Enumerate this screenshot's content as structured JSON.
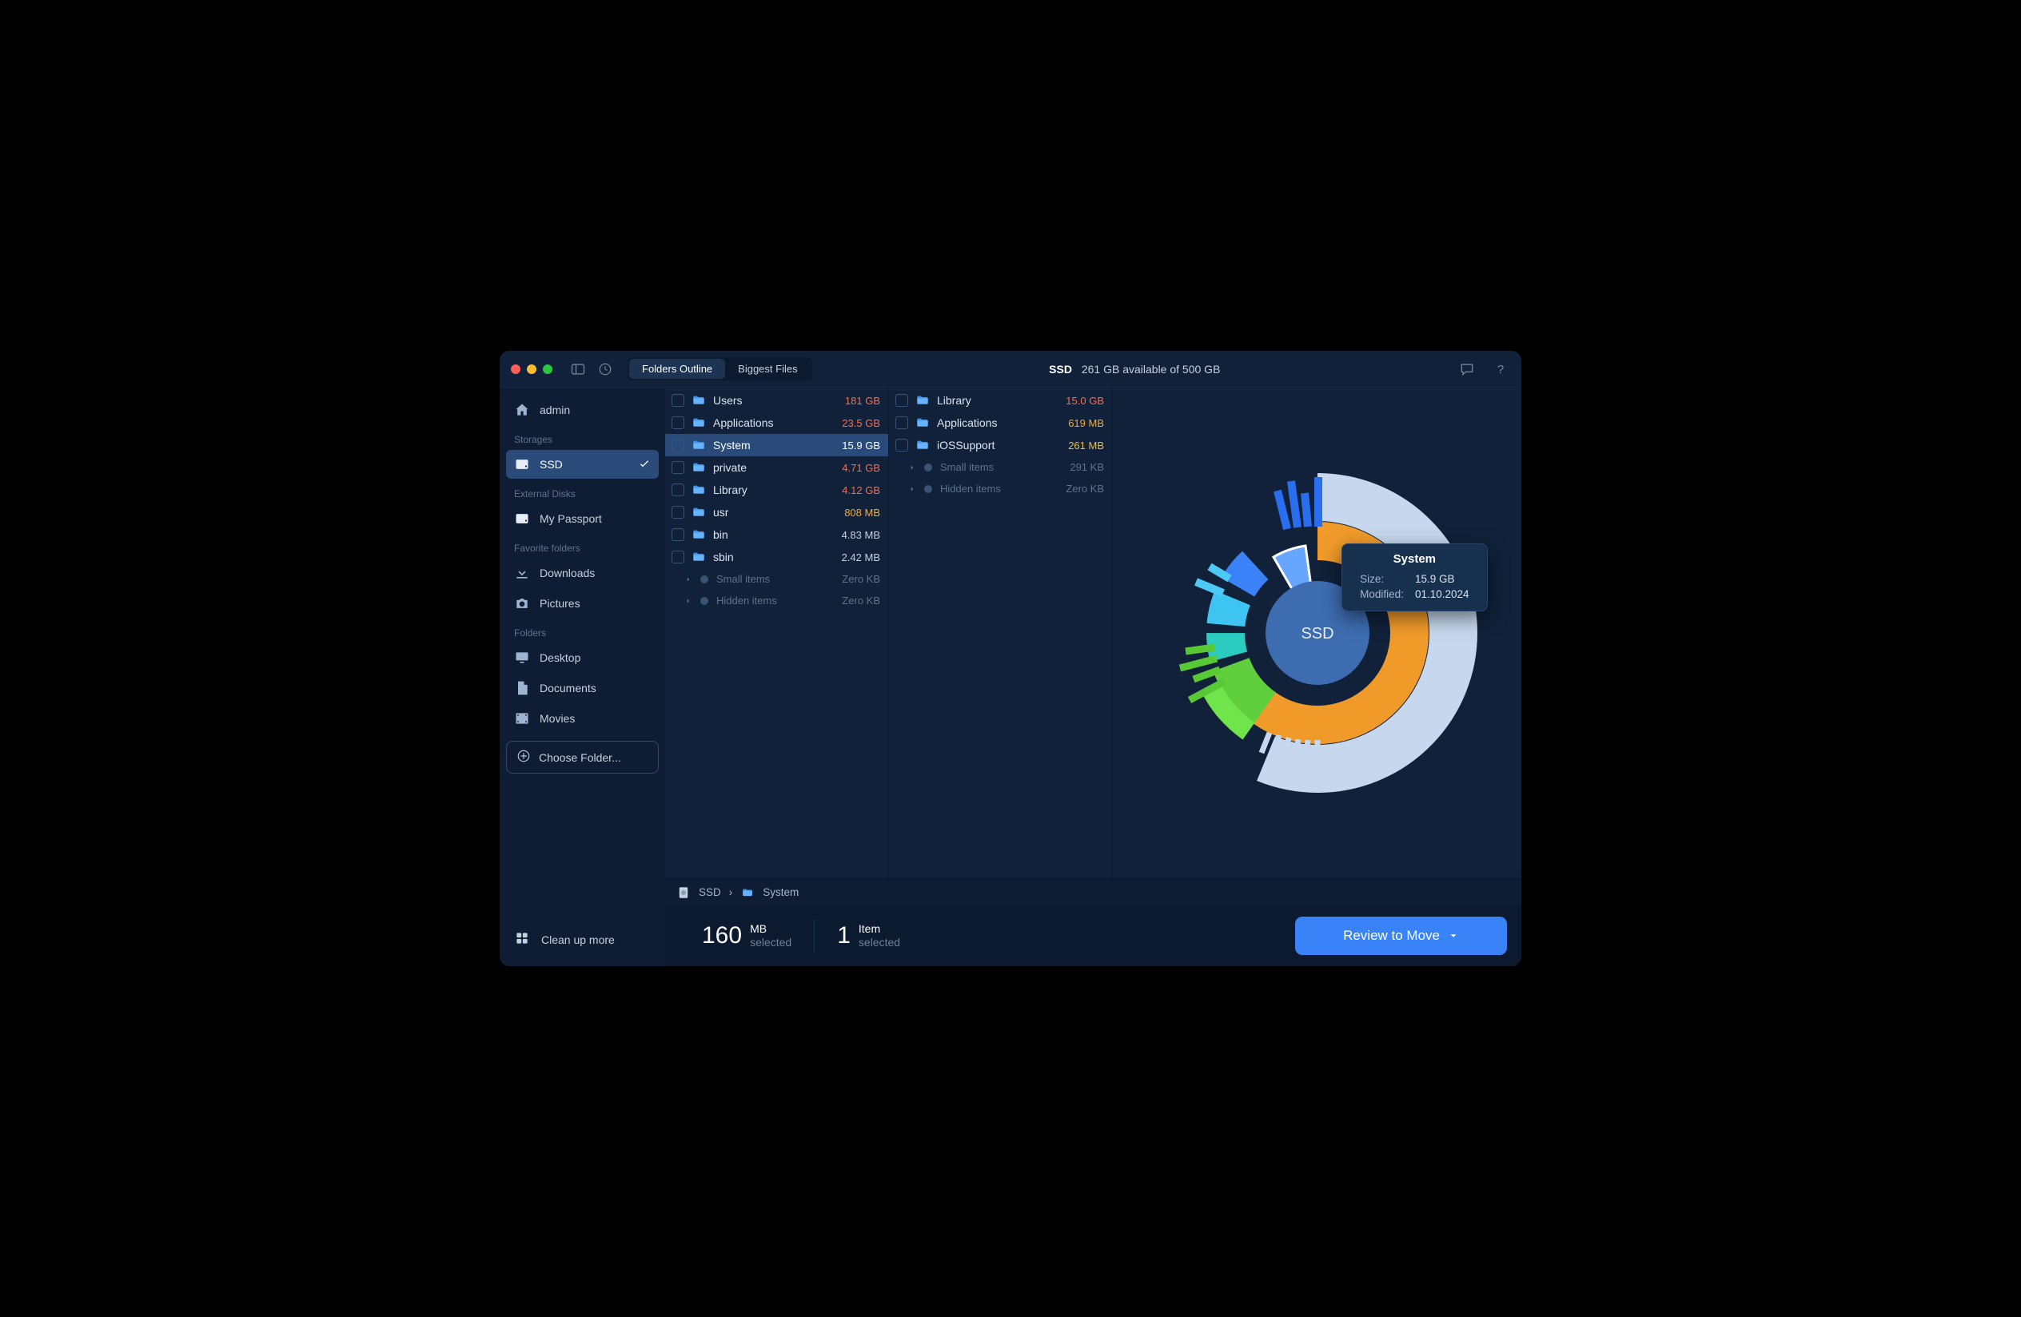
{
  "titlebar": {
    "tabs": {
      "outline": "Folders Outline",
      "biggest": "Biggest Files"
    },
    "disk_name": "SSD",
    "disk_status": "261 GB available of 500 GB"
  },
  "sidebar": {
    "user": "admin",
    "sections": {
      "storages": "Storages",
      "external": "External Disks",
      "favorites": "Favorite folders",
      "folders": "Folders"
    },
    "storages": [
      {
        "name": "SSD",
        "selected": true
      }
    ],
    "external": [
      {
        "name": "My Passport"
      }
    ],
    "favorites": [
      {
        "name": "Downloads"
      },
      {
        "name": "Pictures"
      }
    ],
    "folders": [
      {
        "name": "Desktop"
      },
      {
        "name": "Documents"
      },
      {
        "name": "Movies"
      }
    ],
    "choose": "Choose Folder...",
    "cleanup": "Clean up more"
  },
  "columns": [
    {
      "items": [
        {
          "name": "Users",
          "size": "181 GB",
          "color": "#ff6b4a"
        },
        {
          "name": "Applications",
          "size": "23.5 GB",
          "color": "#ff6b4a"
        },
        {
          "name": "System",
          "size": "15.9 GB",
          "color": "#ff6b4a",
          "selected": true
        },
        {
          "name": "private",
          "size": "4.71 GB",
          "color": "#ff6b4a"
        },
        {
          "name": "Library",
          "size": "4.12 GB",
          "color": "#ff6b4a"
        },
        {
          "name": "usr",
          "size": "808 MB",
          "color": "#f2a93b"
        },
        {
          "name": "bin",
          "size": "4.83 MB",
          "color": "#c5d0de"
        },
        {
          "name": "sbin",
          "size": "2.42 MB",
          "color": "#c5d0de"
        }
      ],
      "meta": [
        {
          "name": "Small items",
          "size": "Zero KB"
        },
        {
          "name": "Hidden items",
          "size": "Zero KB"
        }
      ]
    },
    {
      "items": [
        {
          "name": "Library",
          "size": "15.0 GB",
          "color": "#ff6b4a"
        },
        {
          "name": "Applications",
          "size": "619 MB",
          "color": "#f2a93b"
        },
        {
          "name": "iOSSupport",
          "size": "261 MB",
          "color": "#e8c04a"
        }
      ],
      "meta": [
        {
          "name": "Small items",
          "size": "291 KB"
        },
        {
          "name": "Hidden items",
          "size": "Zero KB"
        }
      ]
    }
  ],
  "viz": {
    "center_label": "SSD",
    "tooltip": {
      "title": "System",
      "rows": [
        {
          "k": "Size:",
          "v": "15.9 GB"
        },
        {
          "k": "Modified:",
          "v": "01.10.2024"
        }
      ]
    }
  },
  "breadcrumb": {
    "root": "SSD",
    "sep": "›",
    "leaf": "System"
  },
  "footer": {
    "size_num": "160",
    "size_unit": "MB",
    "size_sub": "selected",
    "count_num": "1",
    "count_unit": "Item",
    "count_sub": "selected",
    "button": "Review to Move"
  }
}
